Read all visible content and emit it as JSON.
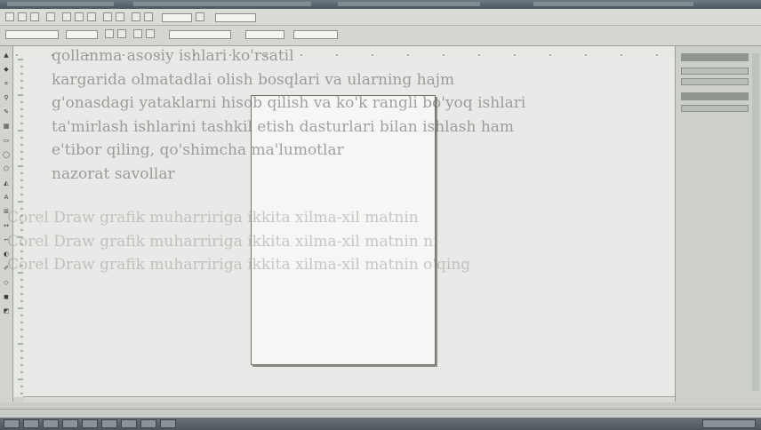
{
  "colors": {
    "toolbar": "#d4d7d1",
    "canvas": "#e9eae7",
    "page": "#f6f6f4",
    "taskbar": "#4f575c"
  },
  "bleed_text": [
    "qollanma asosiy ishlari ko'rsatil",
    "kargarida olmatadlai olish bosqlari va ularning hajm",
    "g'onasdagi yataklarni hisob qilish va ko'k rangli bo'yoq ishlari",
    "ta'mirlash ishlarini tashkil etish dasturlari bilan ishlash ham",
    "e'tibor qiling, qo'shimcha ma'lumotlar",
    "nazorat savollar"
  ],
  "ghost_text": [
    "Corel Draw grafik muharririga ikkita xilma-xil matnin",
    "Corel Draw grafik muharririga ikkita xilma-xil matnin ni",
    "Corel Draw grafik muharririga ikkita xilma-xil matnin o'qing"
  ]
}
